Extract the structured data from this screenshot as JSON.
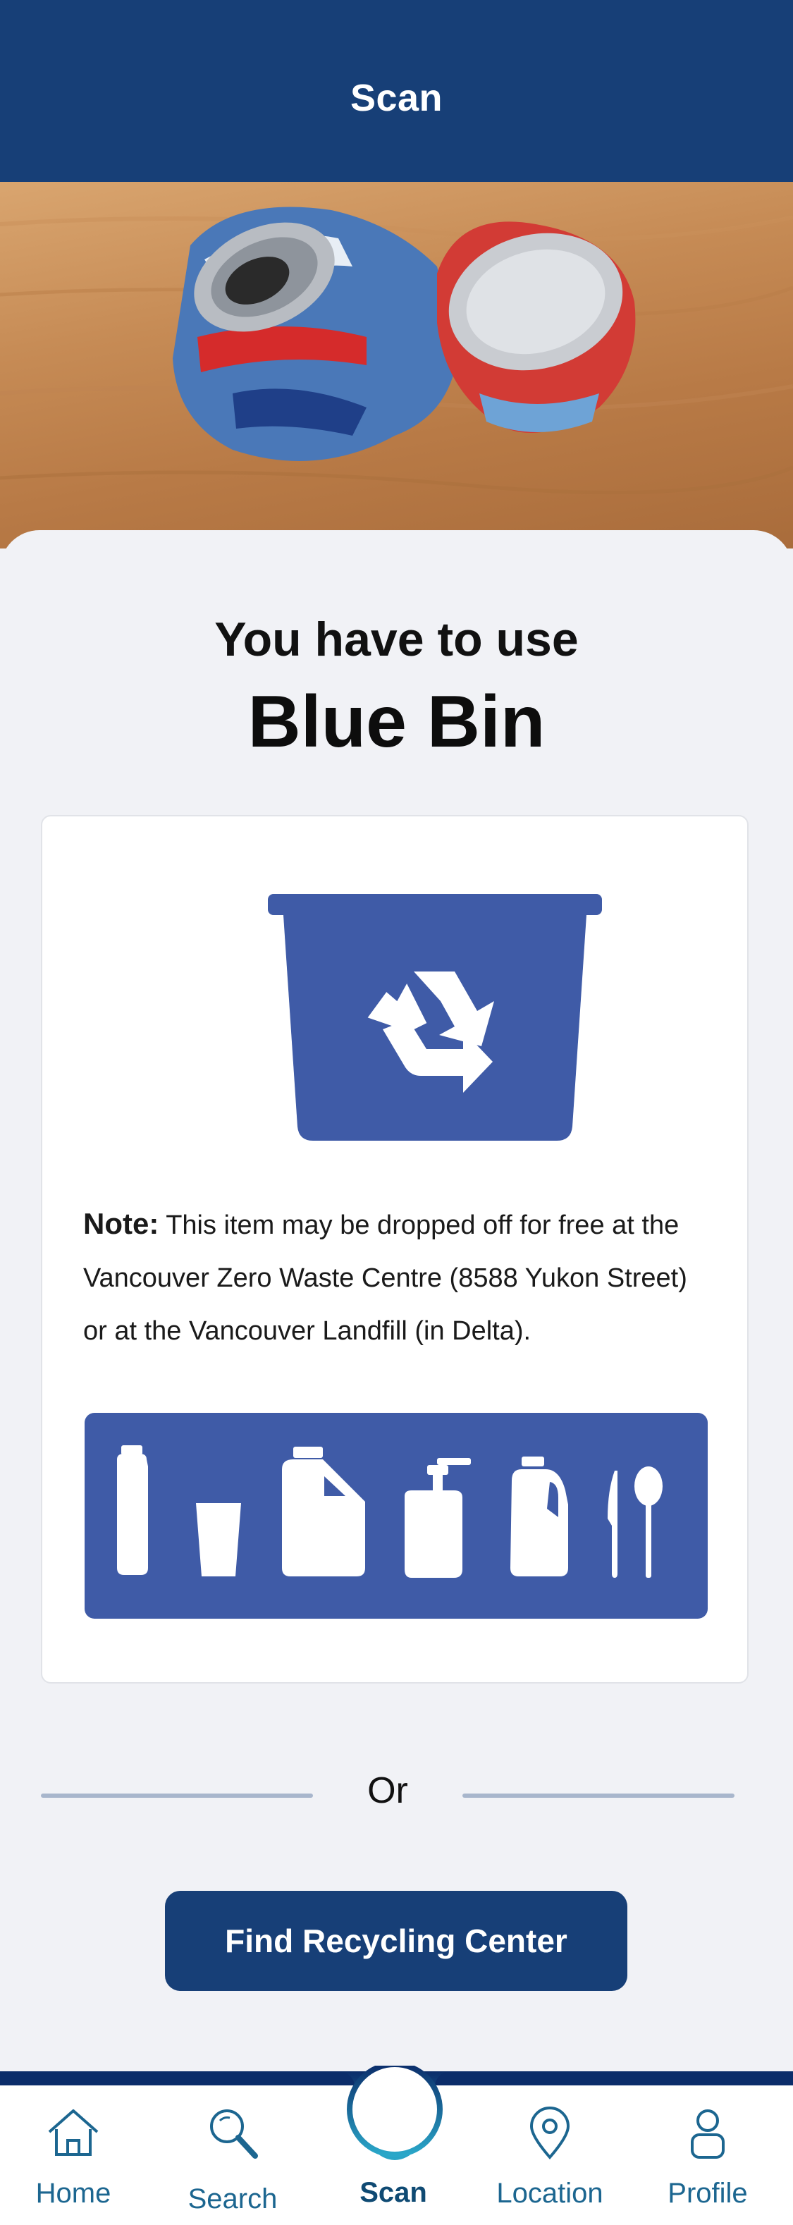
{
  "header": {
    "title": "Scan"
  },
  "result": {
    "line1": "You have to use",
    "bin_name": "Blue Bin"
  },
  "note": {
    "label": "Note:",
    "text": " This item may be dropped off for free at the Vancouver Zero Waste Centre (8588 Yukon Street) or at the Vancouver Landfill (in Delta)."
  },
  "divider": {
    "label": "Or"
  },
  "cta": {
    "label": "Find Recycling Center"
  },
  "nav": {
    "items": [
      {
        "label": "Home",
        "icon": "home-icon"
      },
      {
        "label": "Search",
        "icon": "search-icon"
      },
      {
        "label": "Scan",
        "icon": "scan-icon",
        "active": true
      },
      {
        "label": "Location",
        "icon": "location-pin-icon"
      },
      {
        "label": "Profile",
        "icon": "profile-icon"
      }
    ]
  },
  "colors": {
    "header_bg": "#173f77",
    "bin_blue": "#3f5ba7",
    "nav_accent": "#1c6690",
    "page_bg": "#f1f2f6"
  }
}
